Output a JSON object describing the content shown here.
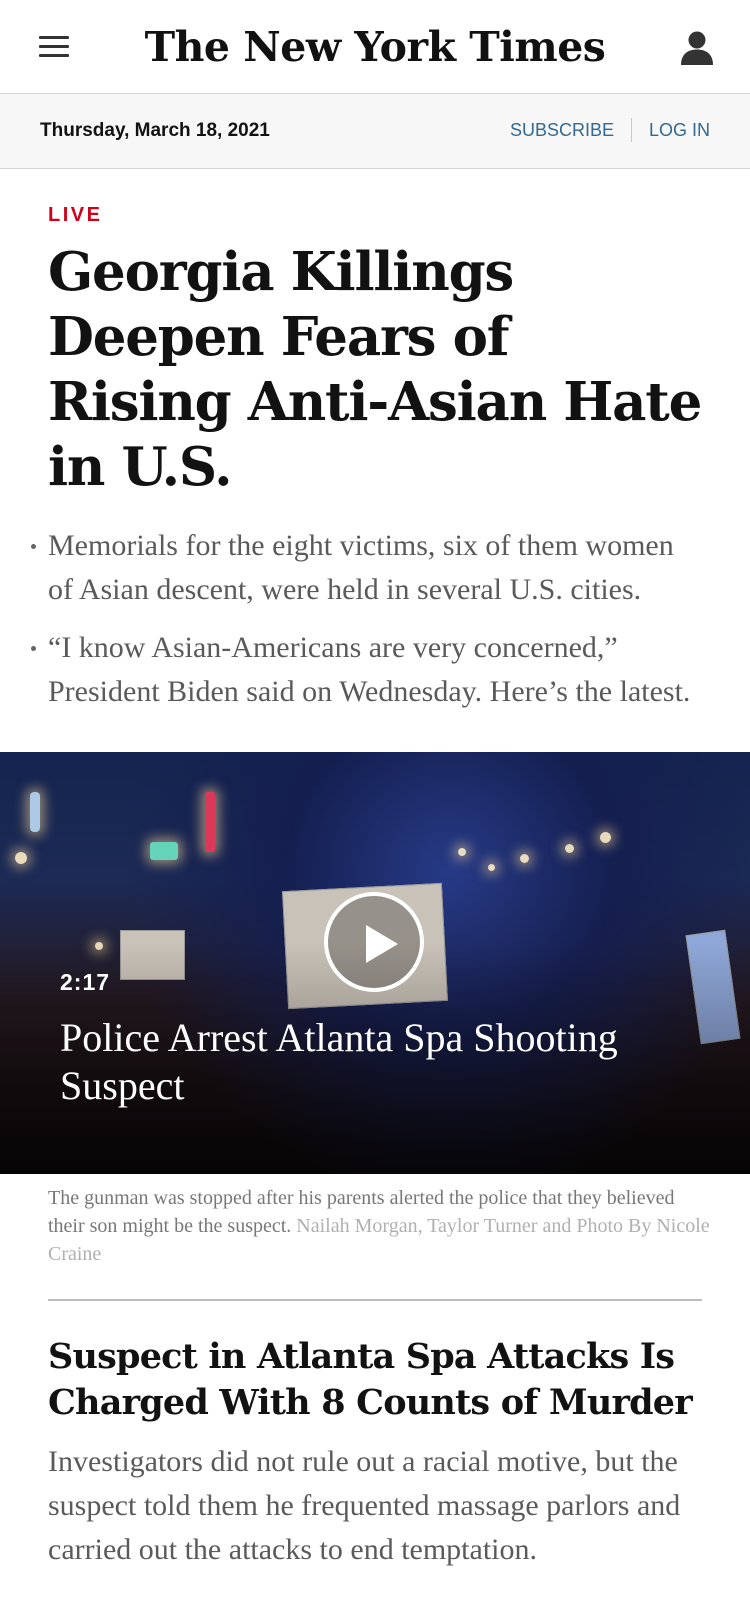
{
  "masthead": {
    "logo_text": "The New York Times"
  },
  "datebar": {
    "date": "Thursday, March 18, 2021",
    "subscribe_label": "SUBSCRIBE",
    "login_label": "LOG IN"
  },
  "lead": {
    "label": "LIVE",
    "headline": "Georgia Killings Deepen Fears of Rising Anti-Asian Hate in U.S.",
    "summary": [
      "Memorials for the eight victims, six of them women of Asian descent, were held in several U.S. cities.",
      "“I know Asian-Americans are very concerned,” President Biden said on Wednesday. Here’s the latest."
    ]
  },
  "video": {
    "duration": "2:17",
    "title": "Police Arrest Atlanta Spa Shooting Suspect",
    "caption": "The gunman was stopped after his parents alerted the police that they believed their son might be the suspect.",
    "credit": "Nailah Morgan, Taylor Turner and Photo By Nicole Craine"
  },
  "story2": {
    "headline": "Suspect in Atlanta Spa Attacks Is Charged With 8 Counts of Murder",
    "summary": "Investigators did not rule out a racial motive, but the suspect told them he frequented massage parlors and carried out the attacks to end temptation."
  },
  "colors": {
    "live_red": "#d0021b",
    "link_blue": "#326891"
  },
  "icons": {
    "menu": "hamburger-menu-icon",
    "account": "user-account-icon",
    "play": "play-icon"
  }
}
